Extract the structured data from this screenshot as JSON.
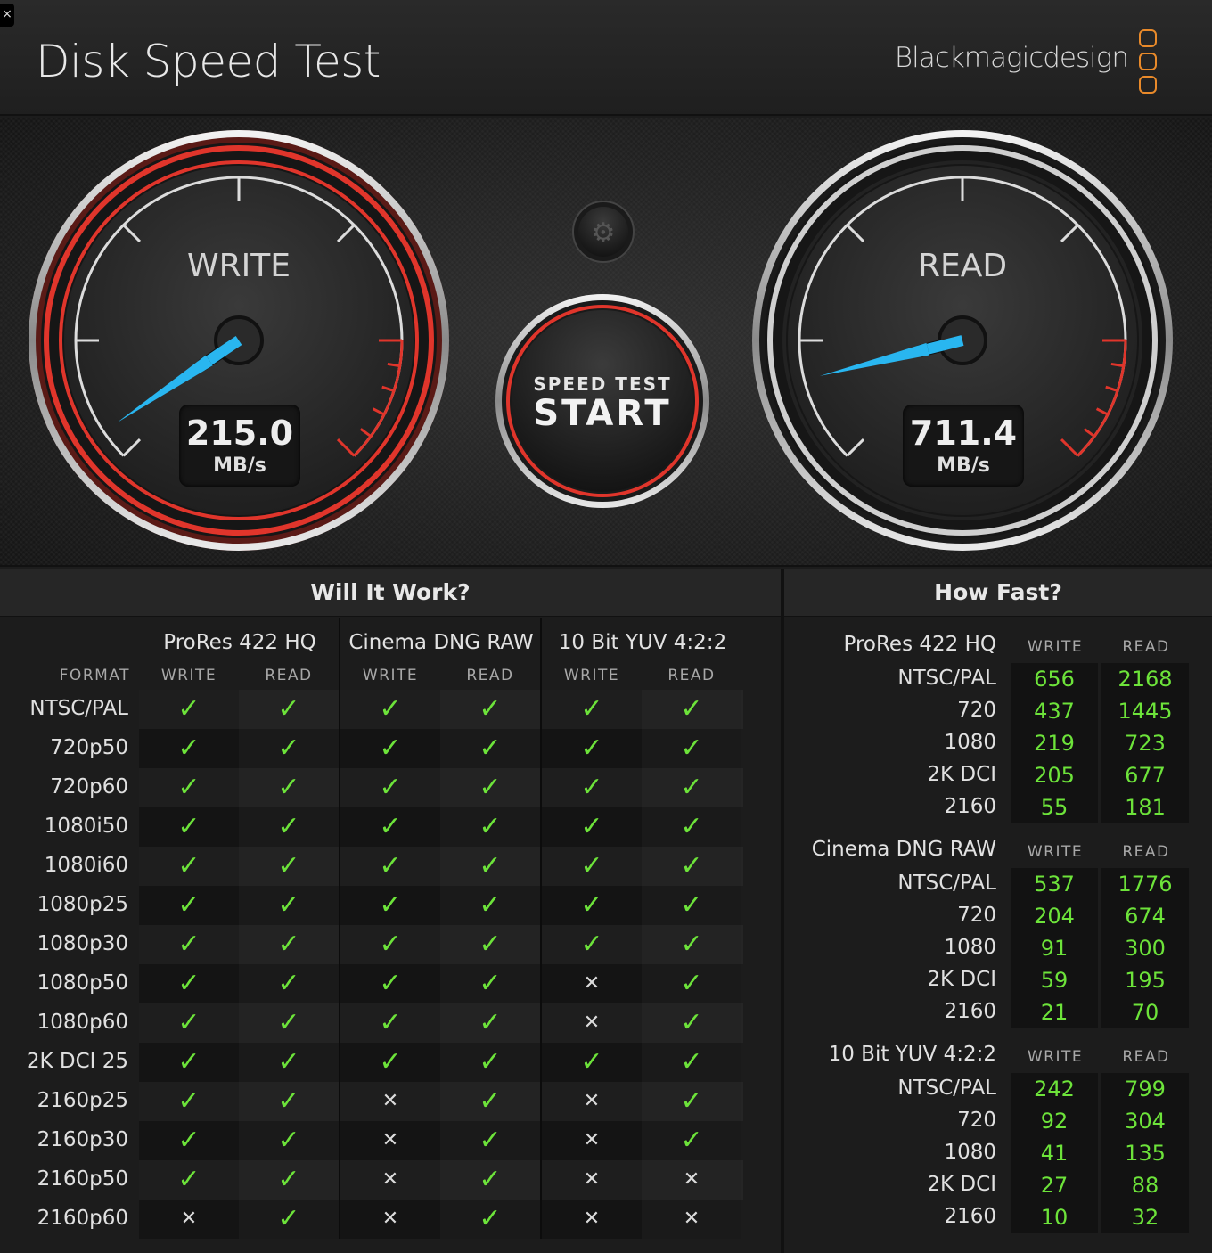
{
  "app": {
    "title": "Disk Speed Test",
    "brand": "Blackmagicdesign",
    "close": "×"
  },
  "write": {
    "label": "WRITE",
    "value": "215.0",
    "unit": "MB/s"
  },
  "read": {
    "label": "READ",
    "value": "711.4",
    "unit": "MB/s"
  },
  "start": {
    "line1": "SPEED TEST",
    "line2": "START"
  },
  "colors": {
    "accent_red": "#e0352b",
    "needle": "#29b6f0",
    "ok": "#6de33a",
    "brand_orange": "#e98a2a"
  },
  "will_it_work": {
    "title": "Will It Work?",
    "format_label": "FORMAT",
    "codecs": [
      "ProRes 422 HQ",
      "Cinema DNG RAW",
      "10 Bit YUV 4:2:2"
    ],
    "write_label": "WRITE",
    "read_label": "READ",
    "rows": [
      {
        "format": "NTSC/PAL",
        "cells": [
          1,
          1,
          1,
          1,
          1,
          1
        ]
      },
      {
        "format": "720p50",
        "cells": [
          1,
          1,
          1,
          1,
          1,
          1
        ]
      },
      {
        "format": "720p60",
        "cells": [
          1,
          1,
          1,
          1,
          1,
          1
        ]
      },
      {
        "format": "1080i50",
        "cells": [
          1,
          1,
          1,
          1,
          1,
          1
        ]
      },
      {
        "format": "1080i60",
        "cells": [
          1,
          1,
          1,
          1,
          1,
          1
        ]
      },
      {
        "format": "1080p25",
        "cells": [
          1,
          1,
          1,
          1,
          1,
          1
        ]
      },
      {
        "format": "1080p30",
        "cells": [
          1,
          1,
          1,
          1,
          1,
          1
        ]
      },
      {
        "format": "1080p50",
        "cells": [
          1,
          1,
          1,
          1,
          0,
          1
        ]
      },
      {
        "format": "1080p60",
        "cells": [
          1,
          1,
          1,
          1,
          0,
          1
        ]
      },
      {
        "format": "2K DCI 25",
        "cells": [
          1,
          1,
          1,
          1,
          1,
          1
        ]
      },
      {
        "format": "2160p25",
        "cells": [
          1,
          1,
          0,
          1,
          0,
          1
        ]
      },
      {
        "format": "2160p30",
        "cells": [
          1,
          1,
          0,
          1,
          0,
          1
        ]
      },
      {
        "format": "2160p50",
        "cells": [
          1,
          1,
          0,
          1,
          0,
          0
        ]
      },
      {
        "format": "2160p60",
        "cells": [
          0,
          1,
          0,
          1,
          0,
          0
        ]
      }
    ],
    "check_glyph": "✓",
    "cross_glyph": "✕"
  },
  "how_fast": {
    "title": "How Fast?",
    "write_label": "WRITE",
    "read_label": "READ",
    "groups": [
      {
        "name": "ProRes 422 HQ",
        "rows": [
          {
            "res": "NTSC/PAL",
            "write": "656",
            "read": "2168"
          },
          {
            "res": "720",
            "write": "437",
            "read": "1445"
          },
          {
            "res": "1080",
            "write": "219",
            "read": "723"
          },
          {
            "res": "2K DCI",
            "write": "205",
            "read": "677"
          },
          {
            "res": "2160",
            "write": "55",
            "read": "181"
          }
        ]
      },
      {
        "name": "Cinema DNG RAW",
        "rows": [
          {
            "res": "NTSC/PAL",
            "write": "537",
            "read": "1776"
          },
          {
            "res": "720",
            "write": "204",
            "read": "674"
          },
          {
            "res": "1080",
            "write": "91",
            "read": "300"
          },
          {
            "res": "2K DCI",
            "write": "59",
            "read": "195"
          },
          {
            "res": "2160",
            "write": "21",
            "read": "70"
          }
        ]
      },
      {
        "name": "10 Bit YUV 4:2:2",
        "rows": [
          {
            "res": "NTSC/PAL",
            "write": "242",
            "read": "799"
          },
          {
            "res": "720",
            "write": "92",
            "read": "304"
          },
          {
            "res": "1080",
            "write": "41",
            "read": "135"
          },
          {
            "res": "2K DCI",
            "write": "27",
            "read": "88"
          },
          {
            "res": "2160",
            "write": "10",
            "read": "32"
          }
        ]
      }
    ]
  }
}
